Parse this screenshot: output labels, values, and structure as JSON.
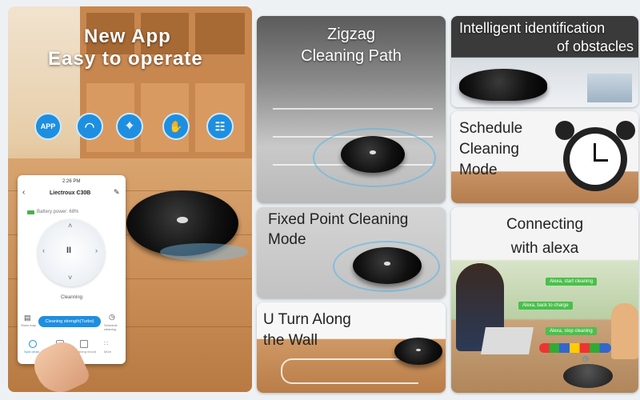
{
  "headline": {
    "line1": "New App",
    "line2": "Easy to operate"
  },
  "app_icons": [
    {
      "name": "app-icon",
      "label": "APP"
    },
    {
      "name": "wifi-icon",
      "label": "◠"
    },
    {
      "name": "location-icon",
      "label": "⌖"
    },
    {
      "name": "gesture-icon",
      "label": "✋"
    },
    {
      "name": "schedule-icon",
      "label": "☷"
    }
  ],
  "phone": {
    "time": "2:26 PM",
    "device_name": "Liectroux C30B",
    "battery": "Battery power: 68%",
    "pause_symbol": "II",
    "mode_label": "Cleanning",
    "strength_button": "Cleaning strength(Turbo)",
    "left_label": "Show map",
    "right_label": "Schedule cleaning",
    "nav": [
      "Spot clean",
      "Returning of",
      "Cleaning record",
      "More"
    ]
  },
  "panels": {
    "zigzag": "Zigzag\nCleaning Path",
    "obstacles_line1": "Intelligent identification",
    "obstacles_line2": "of obstacles",
    "schedule": [
      "Schedule",
      "Cleaning",
      "Mode"
    ],
    "fixed_point": [
      "Fixed Point Cleaning",
      "Mode"
    ],
    "u_turn": [
      "U Turn Along",
      "the Wall"
    ],
    "alexa": [
      "Connecting",
      "with alexa"
    ],
    "alexa_chips": [
      "Alexa, start cleaning",
      "Alexa, back to charge",
      "Alexa, stop cleaning"
    ]
  },
  "colors": {
    "accent": "#1e8fe0",
    "alexa_green": "#49c04b"
  }
}
